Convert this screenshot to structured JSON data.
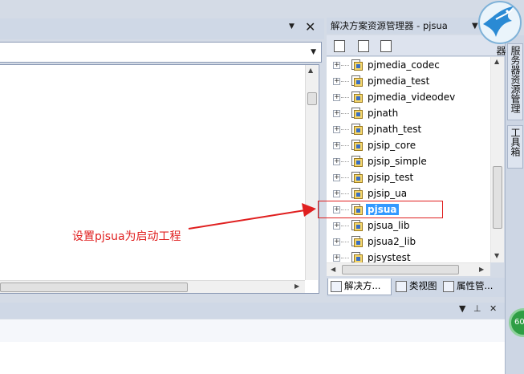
{
  "left_pane": {
    "close_label": "✕",
    "dropdown_arrow": "▼"
  },
  "annotation": {
    "text": "设置pjsua为启动工程",
    "color": "#e02020"
  },
  "solution_explorer": {
    "title": "解决方案资源管理器 - pjsua",
    "projects": [
      {
        "name": "pjmedia_codec",
        "selected": false
      },
      {
        "name": "pjmedia_test",
        "selected": false
      },
      {
        "name": "pjmedia_videodev",
        "selected": false
      },
      {
        "name": "pjnath",
        "selected": false
      },
      {
        "name": "pjnath_test",
        "selected": false
      },
      {
        "name": "pjsip_core",
        "selected": false
      },
      {
        "name": "pjsip_simple",
        "selected": false
      },
      {
        "name": "pjsip_test",
        "selected": false
      },
      {
        "name": "pjsip_ua",
        "selected": false
      },
      {
        "name": "pjsua",
        "selected": true
      },
      {
        "name": "pjsua_lib",
        "selected": false
      },
      {
        "name": "pjsua2_lib",
        "selected": false
      },
      {
        "name": "pjsystest",
        "selected": false
      }
    ],
    "tabs": [
      {
        "label": "解决方...",
        "icon": "solution-explorer-icon",
        "active": true
      },
      {
        "label": "类视图",
        "icon": "class-view-icon",
        "active": false
      },
      {
        "label": "属性管...",
        "icon": "property-manager-icon",
        "active": false
      }
    ]
  },
  "side_tabs": [
    {
      "label": "服务器资源管理器",
      "icon": "server-icon"
    },
    {
      "label": "工具箱",
      "icon": "toolbox-icon"
    }
  ],
  "bottom_pane": {
    "pin_label": "⊥",
    "close_label": "✕"
  },
  "badge": {
    "text": "60"
  },
  "colors": {
    "selection": "#3399ff",
    "annotation": "#e02020"
  }
}
